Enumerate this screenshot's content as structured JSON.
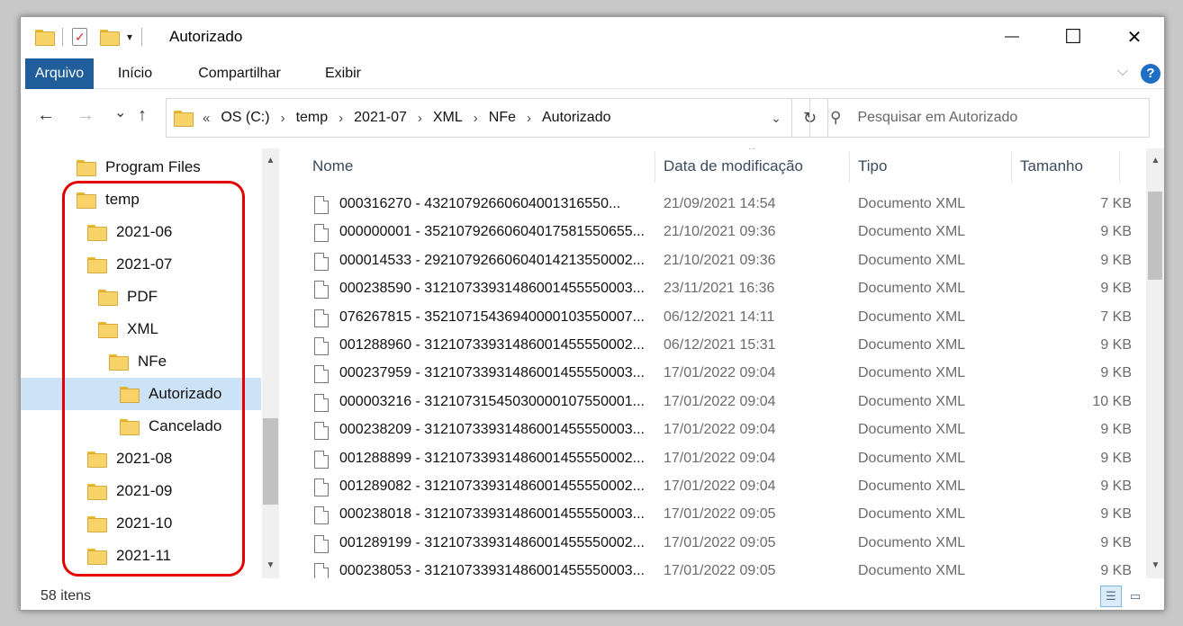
{
  "window": {
    "title": "Autorizado",
    "controls": {
      "minimize": "—",
      "maximize": "☐",
      "close": "✕"
    }
  },
  "ribbon": {
    "tabs": [
      "Arquivo",
      "Início",
      "Compartilhar",
      "Exibir"
    ],
    "active_tab": "Arquivo",
    "expand_glyph": "⌵",
    "help_glyph": "?"
  },
  "navigation": {
    "back_glyph": "←",
    "forward_glyph": "→",
    "recent_glyph": "⌄",
    "up_glyph": "↑",
    "address_overflow": "«",
    "breadcrumb": [
      "OS (C:)",
      "temp",
      "2021-07",
      "XML",
      "NFe",
      "Autorizado"
    ],
    "crumb_separator": "›",
    "dropdown_glyph": "⌄",
    "refresh_glyph": "↻",
    "search_placeholder": "Pesquisar em Autorizado",
    "search_glyph": "⚲"
  },
  "nav_pane": {
    "items": [
      {
        "label": "Program Files",
        "depth": 0
      },
      {
        "label": "temp",
        "depth": 0
      },
      {
        "label": "2021-06",
        "depth": 1
      },
      {
        "label": "2021-07",
        "depth": 1
      },
      {
        "label": "PDF",
        "depth": 2
      },
      {
        "label": "XML",
        "depth": 2
      },
      {
        "label": "NFe",
        "depth": 3
      },
      {
        "label": "Autorizado",
        "depth": 4,
        "selected": true
      },
      {
        "label": "Cancelado",
        "depth": 4
      },
      {
        "label": "2021-08",
        "depth": 1
      },
      {
        "label": "2021-09",
        "depth": 1
      },
      {
        "label": "2021-10",
        "depth": 1
      },
      {
        "label": "2021-11",
        "depth": 1
      }
    ]
  },
  "file_list": {
    "columns": [
      "Nome",
      "Data de modificação",
      "Tipo",
      "Tamanho"
    ],
    "sort_glyph": "^",
    "rows": [
      {
        "name": "000316270 - 43210792660604001316550...",
        "date": "21/09/2021 14:54",
        "type": "Documento XML",
        "size": "7 KB"
      },
      {
        "name": "000000001 - 35210792660604017581550655...",
        "date": "21/10/2021 09:36",
        "type": "Documento XML",
        "size": "9 KB"
      },
      {
        "name": "000014533 - 29210792660604014213550002...",
        "date": "21/10/2021 09:36",
        "type": "Documento XML",
        "size": "9 KB"
      },
      {
        "name": "000238590 - 31210733931486001455550003...",
        "date": "23/11/2021 16:36",
        "type": "Documento XML",
        "size": "9 KB"
      },
      {
        "name": "076267815 - 35210715436940000103550007...",
        "date": "06/12/2021 14:11",
        "type": "Documento XML",
        "size": "7 KB"
      },
      {
        "name": "001288960 - 31210733931486001455550002...",
        "date": "06/12/2021 15:31",
        "type": "Documento XML",
        "size": "9 KB"
      },
      {
        "name": "000237959 - 31210733931486001455550003...",
        "date": "17/01/2022 09:04",
        "type": "Documento XML",
        "size": "9 KB"
      },
      {
        "name": "000003216 - 31210731545030000107550001...",
        "date": "17/01/2022 09:04",
        "type": "Documento XML",
        "size": "10 KB"
      },
      {
        "name": "000238209 - 31210733931486001455550003...",
        "date": "17/01/2022 09:04",
        "type": "Documento XML",
        "size": "9 KB"
      },
      {
        "name": "001288899 - 31210733931486001455550002...",
        "date": "17/01/2022 09:04",
        "type": "Documento XML",
        "size": "9 KB"
      },
      {
        "name": "001289082 - 31210733931486001455550002...",
        "date": "17/01/2022 09:04",
        "type": "Documento XML",
        "size": "9 KB"
      },
      {
        "name": "000238018 - 31210733931486001455550003...",
        "date": "17/01/2022 09:05",
        "type": "Documento XML",
        "size": "9 KB"
      },
      {
        "name": "001289199 - 31210733931486001455550002...",
        "date": "17/01/2022 09:05",
        "type": "Documento XML",
        "size": "9 KB"
      },
      {
        "name": "000238053 - 31210733931486001455550003...",
        "date": "17/01/2022 09:05",
        "type": "Documento XML",
        "size": "9 KB"
      }
    ]
  },
  "status_bar": {
    "item_count": "58 itens",
    "details_view_glyph": "☰",
    "tiles_view_glyph": "▭"
  },
  "colors": {
    "accent": "#1f5e9a",
    "selection": "#cce3f7",
    "highlight_outline": "#e40000",
    "folder": "#f8d36a"
  }
}
